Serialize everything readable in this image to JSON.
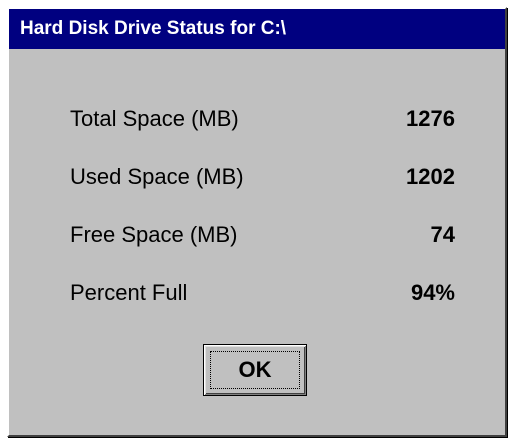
{
  "window": {
    "title": "Hard Disk Drive Status for C:\\"
  },
  "stats": [
    {
      "label": "Total Space (MB)",
      "value": "1276"
    },
    {
      "label": "Used Space (MB)",
      "value": "1202"
    },
    {
      "label": "Free Space (MB)",
      "value": "74"
    },
    {
      "label": "Percent Full",
      "value": "94%"
    }
  ],
  "buttons": {
    "ok_label": "OK"
  },
  "colors": {
    "title_bar": "#000080",
    "dialog_face": "#c0c0c0"
  }
}
